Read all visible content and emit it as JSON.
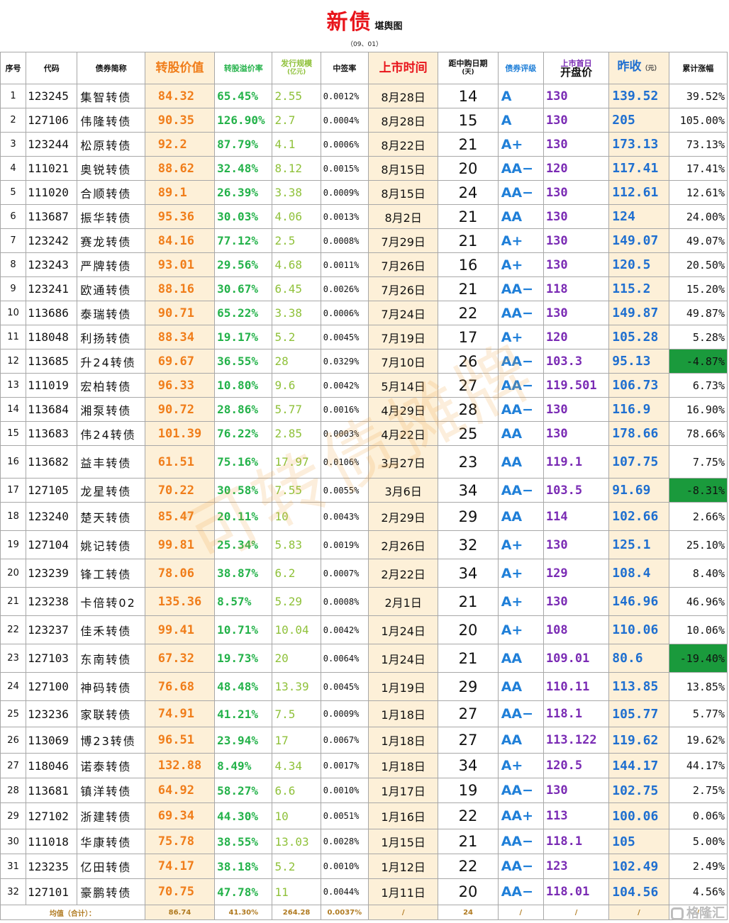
{
  "header": {
    "title": "新债",
    "subtitle": "堪舆图",
    "date": "（09、01）"
  },
  "columns": {
    "idx": "序号",
    "code": "代码",
    "name": "债券简称",
    "conv_value": "转股价值",
    "premium": "转股溢价率",
    "size": "发行规模",
    "size_unit": "(亿元)",
    "win_rate": "中签率",
    "list_date": "上市时间",
    "days_line1": "距中购日期",
    "days_line2": "(天)",
    "rating": "债券评级",
    "open_line1": "上市首日",
    "open_line2": "开盘价",
    "close": "昨收",
    "close_unit": "（元）",
    "change": "累计涨幅"
  },
  "rows": [
    {
      "idx": "1",
      "code": "123245",
      "name": "集智转债",
      "cv": "84.32",
      "prem": "65.45%",
      "size": "2.55",
      "rate": "0.0012%",
      "date": "8月28日",
      "days": "14",
      "rating": "A",
      "open": "130",
      "close": "139.52",
      "chg": "39.52%",
      "neg": false
    },
    {
      "idx": "2",
      "code": "127106",
      "name": "伟隆转债",
      "cv": "90.35",
      "prem": "126.90%",
      "size": "2.7",
      "rate": "0.0004%",
      "date": "8月28日",
      "days": "15",
      "rating": "A",
      "open": "130",
      "close": "205",
      "chg": "105.00%",
      "neg": false
    },
    {
      "idx": "3",
      "code": "123244",
      "name": "松原转债",
      "cv": "92.2",
      "prem": "87.79%",
      "size": "4.1",
      "rate": "0.0006%",
      "date": "8月22日",
      "days": "21",
      "rating": "A+",
      "open": "130",
      "close": "173.13",
      "chg": "73.13%",
      "neg": false
    },
    {
      "idx": "4",
      "code": "111021",
      "name": "奥锐转债",
      "cv": "88.62",
      "prem": "32.48%",
      "size": "8.12",
      "rate": "0.0015%",
      "date": "8月15日",
      "days": "20",
      "rating": "AA−",
      "open": "120",
      "close": "117.41",
      "chg": "17.41%",
      "neg": false
    },
    {
      "idx": "5",
      "code": "111020",
      "name": "合顺转债",
      "cv": "89.1",
      "prem": "26.39%",
      "size": "3.38",
      "rate": "0.0009%",
      "date": "8月15日",
      "days": "24",
      "rating": "AA−",
      "open": "130",
      "close": "112.61",
      "chg": "12.61%",
      "neg": false
    },
    {
      "idx": "6",
      "code": "113687",
      "name": "振华转债",
      "cv": "95.36",
      "prem": "30.03%",
      "size": "4.06",
      "rate": "0.0013%",
      "date": "8月2日",
      "days": "21",
      "rating": "AA",
      "open": "130",
      "close": "124",
      "chg": "24.00%",
      "neg": false
    },
    {
      "idx": "7",
      "code": "123242",
      "name": "赛龙转债",
      "cv": "84.16",
      "prem": "77.12%",
      "size": "2.5",
      "rate": "0.0008%",
      "date": "7月29日",
      "days": "21",
      "rating": "A+",
      "open": "130",
      "close": "149.07",
      "chg": "49.07%",
      "neg": false
    },
    {
      "idx": "8",
      "code": "123243",
      "name": "严牌转债",
      "cv": "93.01",
      "prem": "29.56%",
      "size": "4.68",
      "rate": "0.0011%",
      "date": "7月26日",
      "days": "16",
      "rating": "A+",
      "open": "130",
      "close": "120.5",
      "chg": "20.50%",
      "neg": false
    },
    {
      "idx": "9",
      "code": "123241",
      "name": "欧通转债",
      "cv": "88.16",
      "prem": "30.67%",
      "size": "6.45",
      "rate": "0.0026%",
      "date": "7月26日",
      "days": "21",
      "rating": "AA−",
      "open": "118",
      "close": "115.2",
      "chg": "15.20%",
      "neg": false
    },
    {
      "idx": "10",
      "code": "113686",
      "name": "泰瑞转债",
      "cv": "90.71",
      "prem": "65.22%",
      "size": "3.38",
      "rate": "0.0006%",
      "date": "7月24日",
      "days": "22",
      "rating": "AA−",
      "open": "130",
      "close": "149.87",
      "chg": "49.87%",
      "neg": false
    },
    {
      "idx": "11",
      "code": "118048",
      "name": "利扬转债",
      "cv": "88.34",
      "prem": "19.17%",
      "size": "5.2",
      "rate": "0.0045%",
      "date": "7月19日",
      "days": "17",
      "rating": "A+",
      "open": "120",
      "close": "105.28",
      "chg": "5.28%",
      "neg": false
    },
    {
      "idx": "12",
      "code": "113685",
      "name": "升24转债",
      "cv": "69.67",
      "prem": "36.55%",
      "size": "28",
      "rate": "0.0329%",
      "date": "7月10日",
      "days": "26",
      "rating": "AA−",
      "open": "103.3",
      "close": "95.13",
      "chg": "-4.87%",
      "neg": true
    },
    {
      "idx": "13",
      "code": "111019",
      "name": "宏柏转债",
      "cv": "96.33",
      "prem": "10.80%",
      "size": "9.6",
      "rate": "0.0042%",
      "date": "5月14日",
      "days": "27",
      "rating": "AA−",
      "open": "119.501",
      "close": "106.73",
      "chg": "6.73%",
      "neg": false
    },
    {
      "idx": "14",
      "code": "113684",
      "name": "湘泵转债",
      "cv": "90.72",
      "prem": "28.86%",
      "size": "5.77",
      "rate": "0.0016%",
      "date": "4月29日",
      "days": "28",
      "rating": "AA−",
      "open": "130",
      "close": "116.9",
      "chg": "16.90%",
      "neg": false
    },
    {
      "idx": "15",
      "code": "113683",
      "name": "伟24转债",
      "cv": "101.39",
      "prem": "76.22%",
      "size": "2.85",
      "rate": "0.0003%",
      "date": "4月22日",
      "days": "25",
      "rating": "AA",
      "open": "130",
      "close": "178.66",
      "chg": "78.66%",
      "neg": false
    },
    {
      "idx": "16",
      "code": "113682",
      "name": "益丰转债",
      "cv": "61.51",
      "prem": "75.16%",
      "size": "17.97",
      "rate": "0.0106%",
      "date": "3月27日",
      "days": "23",
      "rating": "AA",
      "open": "119.1",
      "close": "107.75",
      "chg": "7.75%",
      "neg": false
    },
    {
      "idx": "17",
      "code": "127105",
      "name": "龙星转债",
      "cv": "70.22",
      "prem": "30.58%",
      "size": "7.55",
      "rate": "0.0055%",
      "date": "3月6日",
      "days": "34",
      "rating": "AA−",
      "open": "103.5",
      "close": "91.69",
      "chg": "-8.31%",
      "neg": true
    },
    {
      "idx": "18",
      "code": "123240",
      "name": "楚天转债",
      "cv": "85.47",
      "prem": "20.11%",
      "size": "10",
      "rate": "0.0043%",
      "date": "2月29日",
      "days": "29",
      "rating": "AA",
      "open": "114",
      "close": "102.66",
      "chg": "2.66%",
      "neg": false
    },
    {
      "idx": "19",
      "code": "127104",
      "name": "姚记转债",
      "cv": "99.81",
      "prem": "25.34%",
      "size": "5.83",
      "rate": "0.0019%",
      "date": "2月26日",
      "days": "32",
      "rating": "A+",
      "open": "130",
      "close": "125.1",
      "chg": "25.10%",
      "neg": false
    },
    {
      "idx": "20",
      "code": "123239",
      "name": "锋工转债",
      "cv": "78.06",
      "prem": "38.87%",
      "size": "6.2",
      "rate": "0.0007%",
      "date": "2月22日",
      "days": "34",
      "rating": "A+",
      "open": "129",
      "close": "108.4",
      "chg": "8.40%",
      "neg": false
    },
    {
      "idx": "21",
      "code": "123238",
      "name": "卡倍转02",
      "cv": "135.36",
      "prem": "8.57%",
      "size": "5.29",
      "rate": "0.0008%",
      "date": "2月1日",
      "days": "21",
      "rating": "A+",
      "open": "130",
      "close": "146.96",
      "chg": "46.96%",
      "neg": false
    },
    {
      "idx": "22",
      "code": "123237",
      "name": "佳禾转债",
      "cv": "99.41",
      "prem": "10.71%",
      "size": "10.04",
      "rate": "0.0042%",
      "date": "1月24日",
      "days": "20",
      "rating": "A+",
      "open": "108",
      "close": "110.06",
      "chg": "10.06%",
      "neg": false
    },
    {
      "idx": "23",
      "code": "127103",
      "name": "东南转债",
      "cv": "67.32",
      "prem": "19.73%",
      "size": "20",
      "rate": "0.0064%",
      "date": "1月24日",
      "days": "21",
      "rating": "AA",
      "open": "109.01",
      "close": "80.6",
      "chg": "-19.40%",
      "neg": true
    },
    {
      "idx": "24",
      "code": "127100",
      "name": "神码转债",
      "cv": "76.68",
      "prem": "48.48%",
      "size": "13.39",
      "rate": "0.0045%",
      "date": "1月19日",
      "days": "29",
      "rating": "AA",
      "open": "110.11",
      "close": "113.85",
      "chg": "13.85%",
      "neg": false
    },
    {
      "idx": "25",
      "code": "123236",
      "name": "家联转债",
      "cv": "74.91",
      "prem": "41.21%",
      "size": "7.5",
      "rate": "0.0009%",
      "date": "1月18日",
      "days": "27",
      "rating": "AA−",
      "open": "118.1",
      "close": "105.77",
      "chg": "5.77%",
      "neg": false
    },
    {
      "idx": "26",
      "code": "113069",
      "name": "博23转债",
      "cv": "96.51",
      "prem": "23.94%",
      "size": "17",
      "rate": "0.0067%",
      "date": "1月18日",
      "days": "27",
      "rating": "AA",
      "open": "113.122",
      "close": "119.62",
      "chg": "19.62%",
      "neg": false
    },
    {
      "idx": "27",
      "code": "118046",
      "name": "诺泰转债",
      "cv": "132.88",
      "prem": "8.49%",
      "size": "4.34",
      "rate": "0.0017%",
      "date": "1月18日",
      "days": "34",
      "rating": "A+",
      "open": "120.5",
      "close": "144.17",
      "chg": "44.17%",
      "neg": false
    },
    {
      "idx": "28",
      "code": "113681",
      "name": "镇洋转债",
      "cv": "64.92",
      "prem": "58.27%",
      "size": "6.6",
      "rate": "0.0010%",
      "date": "1月17日",
      "days": "19",
      "rating": "AA−",
      "open": "130",
      "close": "102.75",
      "chg": "2.75%",
      "neg": false
    },
    {
      "idx": "29",
      "code": "127102",
      "name": "浙建转债",
      "cv": "69.34",
      "prem": "44.30%",
      "size": "10",
      "rate": "0.0051%",
      "date": "1月16日",
      "days": "22",
      "rating": "AA+",
      "open": "113",
      "close": "100.06",
      "chg": "0.06%",
      "neg": false
    },
    {
      "idx": "30",
      "code": "111018",
      "name": "华康转债",
      "cv": "75.78",
      "prem": "38.55%",
      "size": "13.03",
      "rate": "0.0028%",
      "date": "1月15日",
      "days": "21",
      "rating": "AA−",
      "open": "118.1",
      "close": "105",
      "chg": "5.00%",
      "neg": false
    },
    {
      "idx": "31",
      "code": "123235",
      "name": "亿田转债",
      "cv": "74.17",
      "prem": "38.18%",
      "size": "5.2",
      "rate": "0.0010%",
      "date": "1月12日",
      "days": "22",
      "rating": "AA−",
      "open": "123",
      "close": "102.49",
      "chg": "2.49%",
      "neg": false
    },
    {
      "idx": "32",
      "code": "127101",
      "name": "豪鹏转债",
      "cv": "70.75",
      "prem": "47.78%",
      "size": "11",
      "rate": "0.0044%",
      "date": "1月11日",
      "days": "20",
      "rating": "AA−",
      "open": "118.01",
      "close": "104.56",
      "chg": "4.56%",
      "neg": false
    }
  ],
  "footer": {
    "label": "均值（合计）：",
    "cv": "86.74",
    "prem": "41.30%",
    "size": "264.28",
    "rate": "0.0037%",
    "date": "/",
    "days": "24",
    "rating": "/",
    "open": "/",
    "close": "/",
    "chg": "/"
  },
  "watermark": "可转债摊牌",
  "logo": "格隆汇",
  "colors": {
    "title_red": "#e8141b",
    "conv_value_orange": "#f07d1a",
    "premium_green": "#24b24a",
    "size_green": "#8fc13a",
    "rating_blue": "#1f7fd8",
    "open_purple": "#7a2bb4",
    "close_blue": "#1f6fd0",
    "negative_bg": "#1a9a3c",
    "highlight_bg": "#fdf0d8"
  }
}
